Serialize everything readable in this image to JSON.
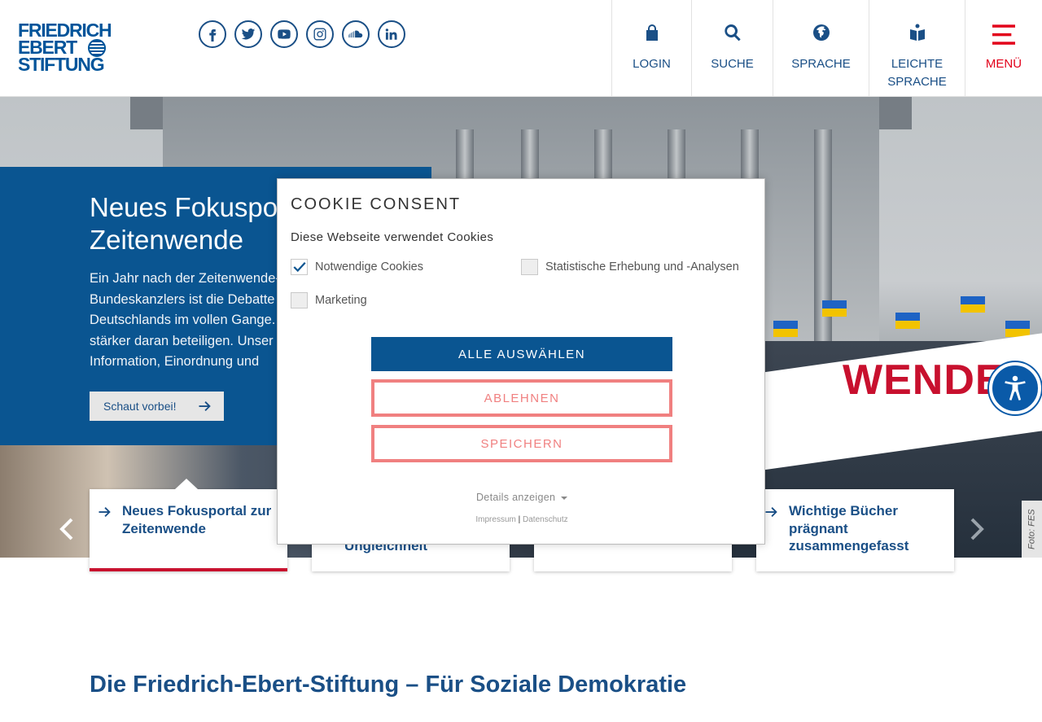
{
  "header": {
    "logo_lines": [
      "FRIEDRICH",
      "EBERT",
      "STIFTUNG"
    ],
    "socials": [
      "facebook-icon",
      "twitter-icon",
      "youtube-icon",
      "instagram-icon",
      "soundcloud-icon",
      "linkedin-icon"
    ],
    "nav": {
      "login": "LOGIN",
      "search": "SUCHE",
      "language": "SPRACHE",
      "easy_language_1": "LEICHTE",
      "easy_language_2": "SPRACHE",
      "menu": "MENÜ"
    }
  },
  "hero": {
    "title": "Neues Fokusportal zur Zeitenwende",
    "text": "Ein Jahr nach der Zeitenwende-Rede des Bundeskanzlers ist die Debatte über die Rolle Deutschlands im vollen Gange. Wir wollen uns noch stärker daran beteiligen. Unser neues Portal bietet Information, Einordnung und",
    "button": "Schaut vorbei!",
    "banner": "WENDE",
    "photo_credit": "Foto: FES"
  },
  "cards": [
    {
      "title": "Neues Fokusportal zur Zeitenwende"
    },
    {
      "title": "Ungleichheit"
    },
    {
      "title": ""
    },
    {
      "title": "Wichtige Bücher prägnant zusammengefasst"
    }
  ],
  "section_title": "Die Friedrich-Ebert-Stiftung – Für Soziale Demokratie",
  "cookie": {
    "title": "COOKIE CONSENT",
    "subtitle": "Diese Webseite verwendet Cookies",
    "options": {
      "necessary": "Notwendige Cookies",
      "statistics": "Statistische Erhebung und -Analysen",
      "marketing": "Marketing"
    },
    "select_all": "ALLE AUSWÄHLEN",
    "reject": "ABLEHNEN",
    "save": "SPEICHERN",
    "details": "Details anzeigen",
    "impressum": "Impressum",
    "separator": "|",
    "privacy": "Datenschutz"
  },
  "colors": {
    "brand_blue": "#0a5591",
    "accent_red": "#c8102e",
    "reject_pink": "#f08080"
  }
}
